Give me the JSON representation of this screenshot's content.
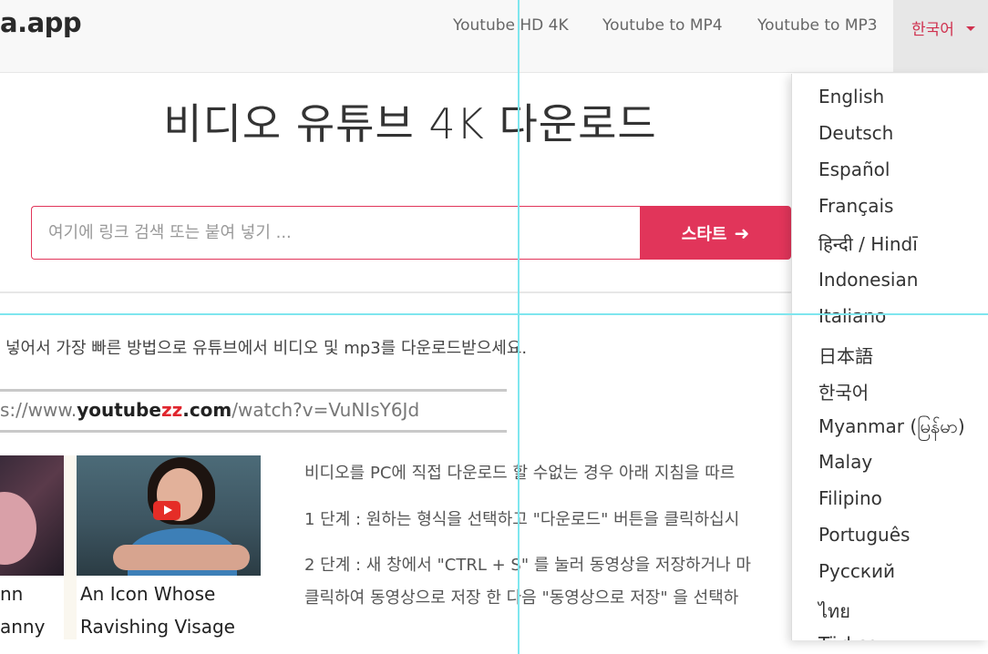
{
  "nav": {
    "brand": "a.app",
    "links": [
      "Youtube HD 4K",
      "Youtube to MP4",
      "Youtube to MP3"
    ],
    "language": "한국어"
  },
  "hero": {
    "title": "비디오 유튜브 4K 다운로드"
  },
  "search": {
    "placeholder": "여기에 링크 검색 또는 붙여 넣기 ...",
    "button_label": "스타트",
    "button_icon": "arrow-right-icon"
  },
  "intro": "넣어서 가장 빠른 방법으로 유튜브에서 비디오 및 mp3를 다운로드받으세요.",
  "url_example": {
    "prefix": "s://www.",
    "youtube": "youtube",
    "zz": "zz",
    "dotcom": ".com",
    "path": "/watch?v=VuNIsY6Jd"
  },
  "cards": [
    {
      "line1": "nn",
      "line2": "anny"
    },
    {
      "line1": "An Icon Whose",
      "line2": "Ravishing Visage"
    }
  ],
  "instructions": [
    "비디오를 PC에 직접 다운로드 할 수없는 경우 아래 지침을 따르",
    "1 단계 : 원하는 형식을 선택하고 \"다운로드\" 버튼을 클릭하십시",
    "2 단계 : 새 창에서 \"CTRL + S\" 를 눌러 동영상을 저장하거나 마",
    "클릭하여 동영상으로 저장 한 다음 \"동영상으로 저장\" 을 선택하"
  ],
  "languages": [
    "English",
    "Deutsch",
    "Español",
    "Français",
    "हिन्दी / Hindī",
    "Indonesian",
    "Italiano",
    "日本語",
    "한국어",
    "Myanmar (မြန်မာ)",
    "Malay",
    "Filipino",
    "Português",
    "Русский",
    "ไทย",
    "Türkçe"
  ],
  "colors": {
    "accent": "#e1355a",
    "nav_bg": "#f8f8f8",
    "guide": "#7fe6ee"
  }
}
